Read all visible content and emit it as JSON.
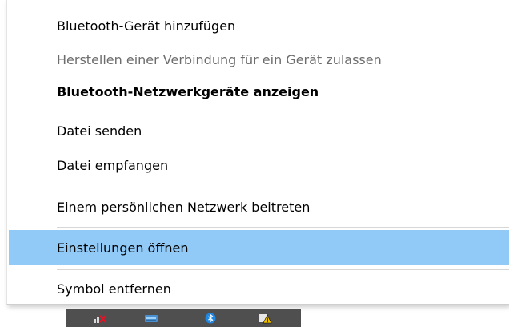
{
  "menu": {
    "items": [
      {
        "label": "Bluetooth-Gerät hinzufügen",
        "state": "normal"
      },
      {
        "label": "Herstellen einer Verbindung für ein Gerät zulassen",
        "state": "disabled"
      },
      {
        "label": "Bluetooth-Netzwerkgeräte anzeigen",
        "state": "bold"
      },
      {
        "label": "Datei senden",
        "state": "normal"
      },
      {
        "label": "Datei empfangen",
        "state": "normal"
      },
      {
        "label": "Einem persönlichen Netzwerk beitreten",
        "state": "normal"
      },
      {
        "label": "Einstellungen öffnen",
        "state": "highlighted"
      },
      {
        "label": "Symbol entfernen",
        "state": "normal"
      }
    ],
    "highlight_color": "#91c9f7",
    "disabled_color": "#6d6d6d"
  },
  "taskbar": {
    "tray_icons": [
      "network-error-icon",
      "storage-icon",
      "bluetooth-icon",
      "action-center-warning-icon"
    ],
    "background": "#4f4f4f"
  }
}
